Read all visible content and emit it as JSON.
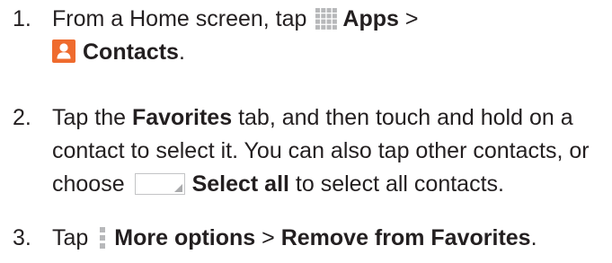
{
  "steps": [
    {
      "number": "1.",
      "text_a": "From a Home screen, tap ",
      "apps_label": "Apps",
      "sep": " >",
      "contacts_label": "Contacts",
      "end": "."
    },
    {
      "number": "2.",
      "text_a": "Tap the ",
      "favorites_label": "Favorites",
      "text_b": " tab, and then touch and hold on a contact to select it. You can also tap other contacts, or choose ",
      "select_all_label": "Select all",
      "text_c": " to select all contacts."
    },
    {
      "number": "3.",
      "text_a": "Tap ",
      "more_options_label": "More options",
      "sep": " > ",
      "remove_label": "Remove from Favorites",
      "end": "."
    }
  ],
  "icons": {
    "apps": "apps-grid-icon",
    "contacts": "contacts-app-icon",
    "checkbox": "select-all-checkbox-icon",
    "more": "more-options-icon"
  },
  "colors": {
    "text": "#231f20",
    "contacts_icon_bg": "#ef6b2e",
    "icon_gray": "#b7b8ba"
  }
}
